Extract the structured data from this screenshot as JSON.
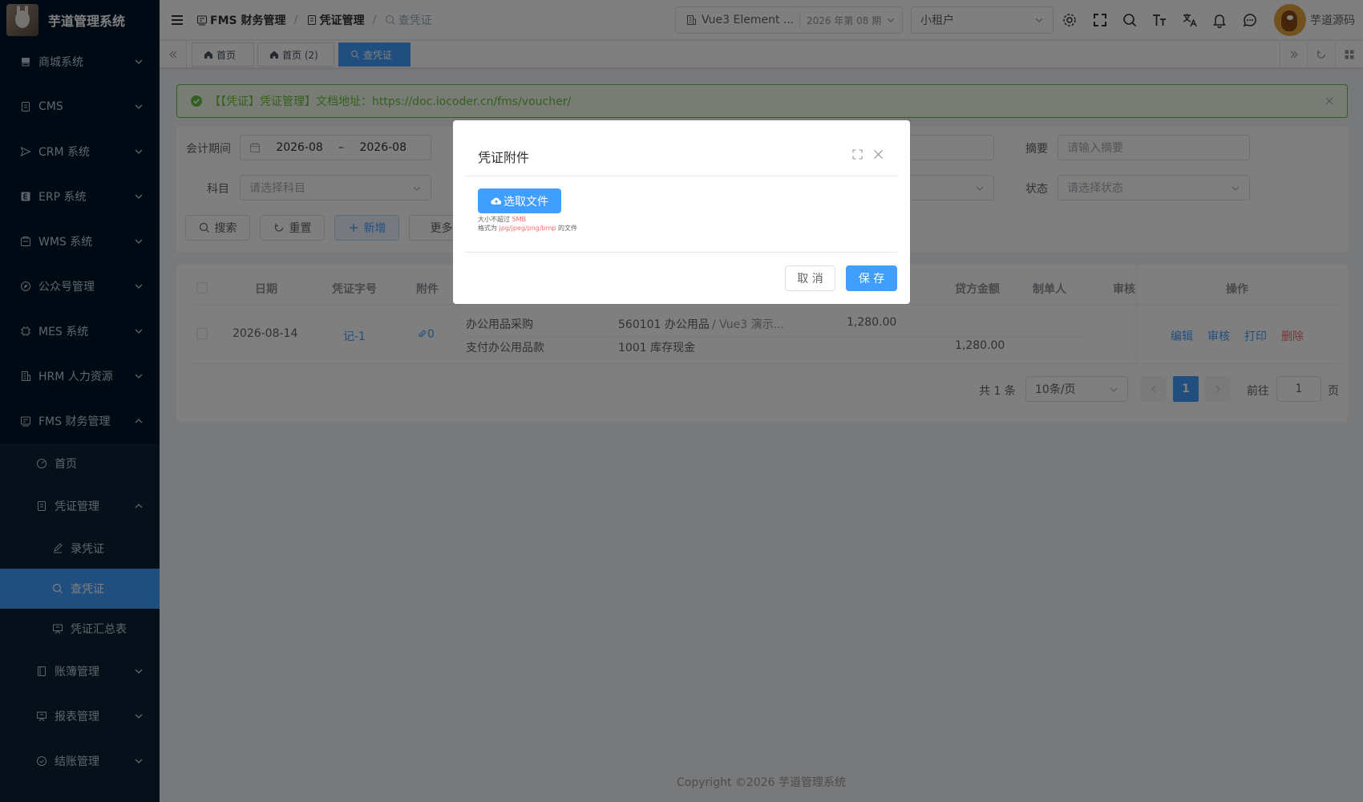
{
  "app": {
    "title": "芋道管理系统"
  },
  "sidebar": {
    "items": [
      {
        "label": "商城系统",
        "icon": "shop-icon"
      },
      {
        "label": "CMS",
        "icon": "document-icon"
      },
      {
        "label": "CRM 系统",
        "icon": "send-icon"
      },
      {
        "label": "ERP 系统",
        "icon": "erp-icon"
      },
      {
        "label": "WMS 系统",
        "icon": "warehouse-icon"
      },
      {
        "label": "公众号管理",
        "icon": "compass-icon"
      },
      {
        "label": "MES 系统",
        "icon": "chip-icon"
      },
      {
        "label": "HRM 人力资源",
        "icon": "building-icon"
      },
      {
        "label": "FMS 财务管理",
        "icon": "finance-icon"
      }
    ],
    "fms_children": [
      {
        "label": "首页",
        "icon": "dashboard-icon"
      },
      {
        "label": "凭证管理",
        "icon": "document-icon"
      }
    ],
    "voucher_children": [
      {
        "label": "录凭证",
        "icon": "edit-icon"
      },
      {
        "label": "查凭证",
        "icon": "search-icon"
      },
      {
        "label": "凭证汇总表",
        "icon": "board-icon"
      }
    ],
    "fms_rest": [
      {
        "label": "账簿管理",
        "icon": "book-icon"
      },
      {
        "label": "报表管理",
        "icon": "board-icon"
      },
      {
        "label": "结账管理",
        "icon": "check-circle-icon"
      }
    ]
  },
  "navbar": {
    "breadcrumb": [
      "FMS 财务管理",
      "凭证管理",
      "查凭证"
    ],
    "tenant_name": "Vue3 Element ...",
    "period": "2026 年第 08 期",
    "tenant_select": "小租户",
    "user_name": "芋道源码"
  },
  "tags": [
    {
      "label": "首页",
      "icon": "home-icon"
    },
    {
      "label": "首页 (2)",
      "icon": "home-icon"
    },
    {
      "label": "查凭证",
      "icon": "search-icon"
    }
  ],
  "alert": {
    "text": "【【凭证】凭证管理】文档地址：https://doc.iocoder.cn/fms/voucher/"
  },
  "search": {
    "period_label": "会计期间",
    "period_start": "2026-08",
    "period_sep": "–",
    "period_end": "2026-08",
    "summary_label": "摘要",
    "summary_placeholder": "请输入摘要",
    "subject_label": "科目",
    "subject_placeholder": "请选择科目",
    "status_label": "状态",
    "status_placeholder": "请选择状态",
    "btn_search": "搜索",
    "btn_reset": "重置",
    "btn_add": "新增",
    "btn_more": "更多"
  },
  "table": {
    "headers": {
      "date": "日期",
      "voucher_no": "凭证字号",
      "attachment": "附件",
      "credit": "贷方金额",
      "maker": "制单人",
      "auditor": "审核人",
      "actions": "操作"
    },
    "row": {
      "date": "2026-08-14",
      "voucher_no": "记-1",
      "attachment_count": "0",
      "entries": [
        {
          "summary": "办公用品采购",
          "subject": "560101 办公用品",
          "subject_extra": "/ Vue3 演示...",
          "debit": "1,280.00",
          "credit": ""
        },
        {
          "summary": "支付办公用品款",
          "subject": "1001 库存现金",
          "subject_extra": "",
          "debit": "",
          "credit": "1,280.00"
        }
      ],
      "actions": {
        "edit": "编辑",
        "audit": "审核",
        "print": "打印",
        "delete": "删除"
      }
    }
  },
  "pagination": {
    "total": "共 1 条",
    "page_size": "10条/页",
    "current_page": "1",
    "goto_label": "前往",
    "goto_value": "1",
    "page_suffix": "页"
  },
  "footer": {
    "text": "Copyright ©2026 芋道管理系统"
  },
  "dialog": {
    "title": "凭证附件",
    "upload_label": "选取文件",
    "tip_size_prefix": "大小不超过",
    "tip_size_value": "5MB",
    "tip_format_prefix": "格式为",
    "tip_format_value": "jpg/jpeg/png/bmp",
    "tip_format_suffix": "的文件",
    "cancel_label": "取 消",
    "save_label": "保 存"
  },
  "colors": {
    "primary": "#409eff",
    "sidebar_bg": "#001529",
    "success": "#67c23a",
    "danger": "#f56c6c"
  }
}
